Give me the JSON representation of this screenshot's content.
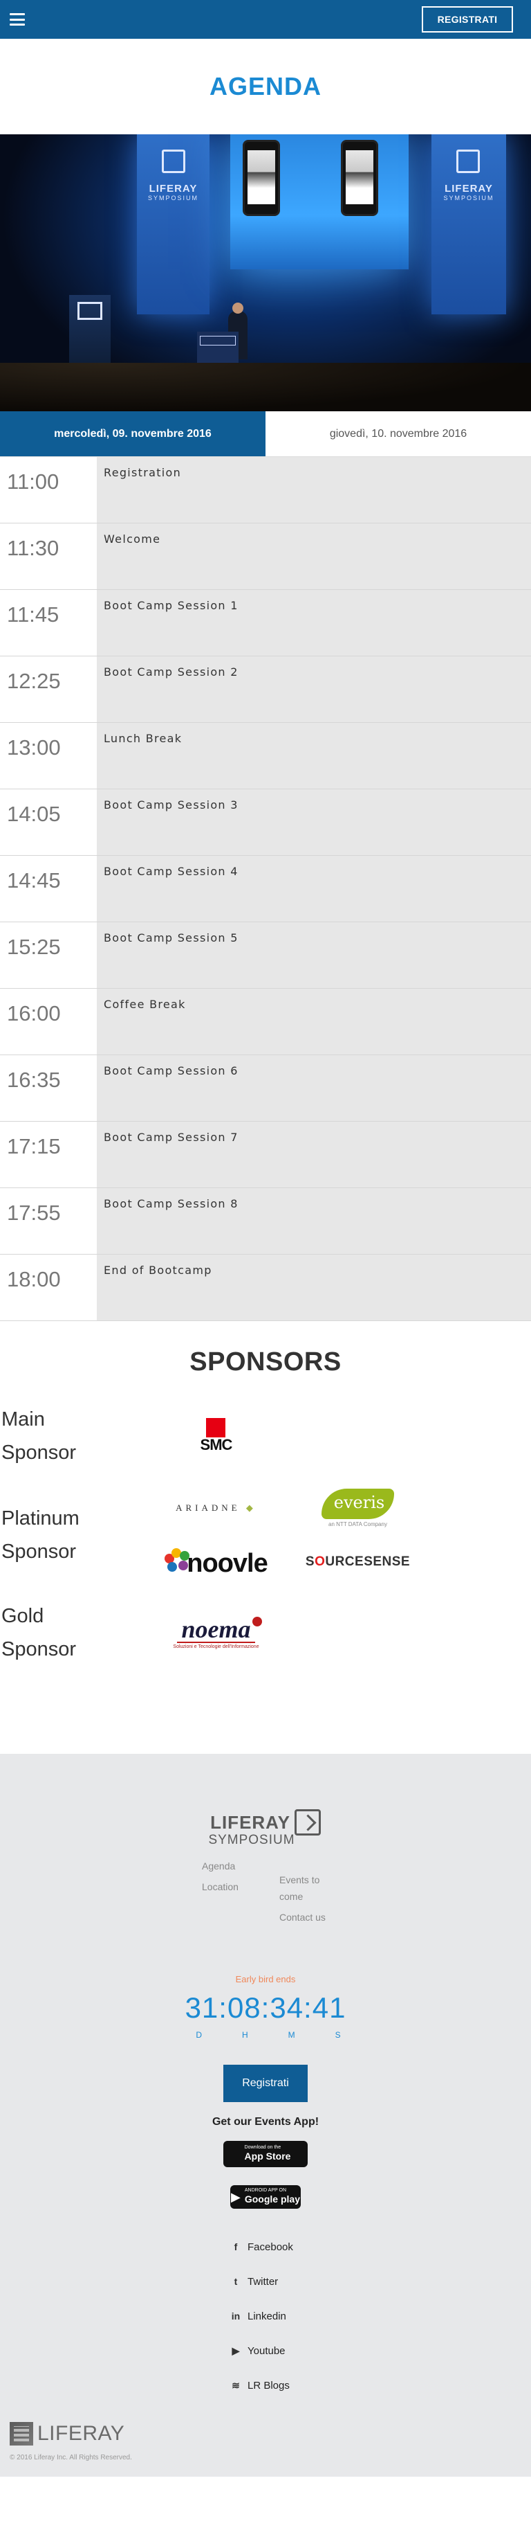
{
  "header": {
    "register_label": "REGISTRATI"
  },
  "page": {
    "title": "AGENDA"
  },
  "hero": {
    "banner_left": "LIFERAY",
    "banner_left_sub": "SYMPOSIUM",
    "banner_right": "LIFERAY",
    "banner_right_sub": "SYMPOSIUM"
  },
  "tabs": [
    {
      "label": "mercoledì, 09. novembre 2016",
      "active": true
    },
    {
      "label": "giovedì, 10. novembre 2016",
      "active": false
    }
  ],
  "agenda": [
    {
      "time": "11:00",
      "title": "Registration"
    },
    {
      "time": "11:30",
      "title": "Welcome"
    },
    {
      "time": "11:45",
      "title": "Boot Camp Session 1"
    },
    {
      "time": "12:25",
      "title": "Boot Camp Session 2"
    },
    {
      "time": "13:00",
      "title": "Lunch Break"
    },
    {
      "time": "14:05",
      "title": "Boot Camp Session 3"
    },
    {
      "time": "14:45",
      "title": "Boot Camp Session 4"
    },
    {
      "time": "15:25",
      "title": "Boot Camp Session 5"
    },
    {
      "time": "16:00",
      "title": "Coffee Break"
    },
    {
      "time": "16:35",
      "title": "Boot Camp Session 6"
    },
    {
      "time": "17:15",
      "title": "Boot Camp Session 7"
    },
    {
      "time": "17:55",
      "title": "Boot Camp Session 8"
    },
    {
      "time": "18:00",
      "title": "End of Bootcamp"
    }
  ],
  "sponsors": {
    "heading": "SPONSORS",
    "tiers": [
      {
        "label_line1": "Main",
        "label_line2": "Sponsor"
      },
      {
        "label_line1": "Platinum",
        "label_line2": "Sponsor"
      },
      {
        "label_line1": "Gold",
        "label_line2": "Sponsor"
      }
    ],
    "logos": {
      "smc": "SMC",
      "ariadne": "ARIADNE",
      "everis": "everis",
      "everis_sub": "an NTT DATA Company",
      "noovle": "noovle",
      "sourcesense": {
        "pre": "S",
        "o": "O",
        "post": "URCESENSE"
      },
      "noema": "noema",
      "noema_sub": "Soluzioni e Tecnologie dell'Informazione"
    }
  },
  "footer": {
    "brand_name": "LIFERAY",
    "brand_sub": "SYMPOSIUM",
    "links_left": [
      "Agenda",
      "Location"
    ],
    "links_right": [
      "Events to come",
      "Contact us"
    ],
    "early_bird": "Early bird ends",
    "countdown": "31:08:34:41",
    "countdown_labels": [
      "D",
      "H",
      "M",
      "S"
    ],
    "register_label": "Registrati",
    "get_app": "Get our Events App!",
    "appstore_small": "Download on the",
    "appstore_big": "App Store",
    "googleplay_small": "ANDROID APP ON",
    "googleplay_big": "Google play",
    "socials": [
      {
        "icon": "f",
        "label": "Facebook"
      },
      {
        "icon": "t",
        "label": "Twitter"
      },
      {
        "icon": "in",
        "label": "Linkedin"
      },
      {
        "icon": "▶",
        "label": "Youtube"
      },
      {
        "icon": "≋",
        "label": "LR Blogs"
      }
    ],
    "company_logo": "LIFERAY",
    "copyright": "© 2016 Liferay Inc. All Rights Reserved."
  },
  "colors": {
    "primary": "#0f5d95",
    "accent": "#1b8ad3",
    "early_bird": "#f0885a",
    "row_bg": "#e7e7e7",
    "footer_bg": "#e7e8ea"
  }
}
